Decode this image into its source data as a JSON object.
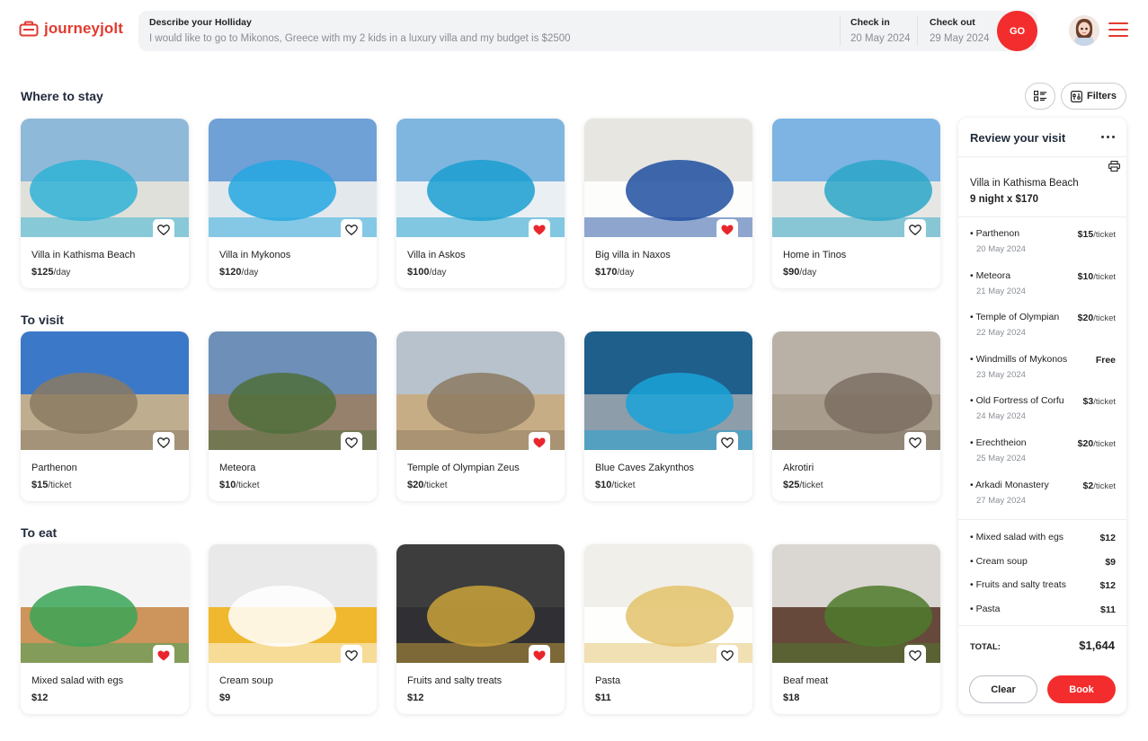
{
  "brand": {
    "name": "journeyjolt",
    "color": "#e23a2e"
  },
  "search": {
    "label": "Describe your Holliday",
    "value": "I would like to go to Mikonos, Greece with my 2 kids in a luxury villa and my budget is $2500",
    "check_in_label": "Check in",
    "check_in_value": "20 May 2024",
    "check_out_label": "Check out",
    "check_out_value": "29 May 2024",
    "go_label": "GO"
  },
  "toolbar": {
    "filters_label": "Filters"
  },
  "sections": {
    "stay": {
      "title": "Where to stay",
      "cards": [
        {
          "name": "Villa in Kathisma Beach",
          "price": "$125",
          "unit": "/day",
          "favorite": false
        },
        {
          "name": "Villa in Mykonos",
          "price": "$120",
          "unit": "/day",
          "favorite": false
        },
        {
          "name": "Villa in Askos",
          "price": "$100",
          "unit": "/day",
          "favorite": true
        },
        {
          "name": "Big villa in Naxos",
          "price": "$170",
          "unit": "/day",
          "favorite": true
        },
        {
          "name": "Home in Tinos",
          "price": "$90",
          "unit": "/day",
          "favorite": false
        }
      ]
    },
    "visit": {
      "title": "To visit",
      "cards": [
        {
          "name": "Parthenon",
          "price": "$15",
          "unit": "/ticket",
          "favorite": false
        },
        {
          "name": "Meteora",
          "price": "$10",
          "unit": "/ticket",
          "favorite": false
        },
        {
          "name": "Temple of Olympian Zeus",
          "price": "$20",
          "unit": "/ticket",
          "favorite": true
        },
        {
          "name": "Blue Caves Zakynthos",
          "price": "$10",
          "unit": "/ticket",
          "favorite": false
        },
        {
          "name": "Akrotiri",
          "price": "$25",
          "unit": "/ticket",
          "favorite": false
        }
      ]
    },
    "eat": {
      "title": "To eat",
      "cards": [
        {
          "name": "Mixed salad with egs",
          "price": "$12",
          "unit": "",
          "favorite": true
        },
        {
          "name": "Cream soup",
          "price": "$9",
          "unit": "",
          "favorite": false
        },
        {
          "name": "Fruits and salty treats",
          "price": "$12",
          "unit": "",
          "favorite": true
        },
        {
          "name": "Pasta",
          "price": "$11",
          "unit": "",
          "favorite": false
        },
        {
          "name": "Beaf meat",
          "price": "$18",
          "unit": "",
          "favorite": false
        }
      ]
    }
  },
  "review": {
    "title": "Review your visit",
    "stay_name": "Villa in Kathisma Beach",
    "stay_nights": "9 night x $170",
    "visits": [
      {
        "name": "• Parthenon",
        "date": "20 May 2024",
        "price": "$15",
        "unit": "/ticket"
      },
      {
        "name": "• Meteora",
        "date": "21 May 2024",
        "price": "$10",
        "unit": "/ticket"
      },
      {
        "name": "• Temple of Olympian",
        "date": "22 May 2024",
        "price": "$20",
        "unit": "/ticket"
      },
      {
        "name": "• Windmills of Mykonos",
        "date": "23 May 2024",
        "price": "Free",
        "unit": ""
      },
      {
        "name": "• Old Fortress of Corfu",
        "date": "24 May 2024",
        "price": "$3",
        "unit": "/ticket"
      },
      {
        "name": "• Erechtheion",
        "date": "25 May 2024",
        "price": "$20",
        "unit": "/ticket"
      },
      {
        "name": "• Arkadi Monastery",
        "date": "27 May 2024",
        "price": "$2",
        "unit": "/ticket"
      }
    ],
    "food": [
      {
        "name": "• Mixed salad with egs",
        "price": "$12"
      },
      {
        "name": "• Cream soup",
        "price": "$9"
      },
      {
        "name": "• Fruits and salty treats",
        "price": "$12"
      },
      {
        "name": "• Pasta",
        "price": "$11"
      }
    ],
    "total_label": "TOTAL:",
    "total_value": "$1,644",
    "clear_label": "Clear",
    "book_label": "Book"
  },
  "colors": {
    "accent": "#f32d2d",
    "heart": "#e8262c"
  }
}
